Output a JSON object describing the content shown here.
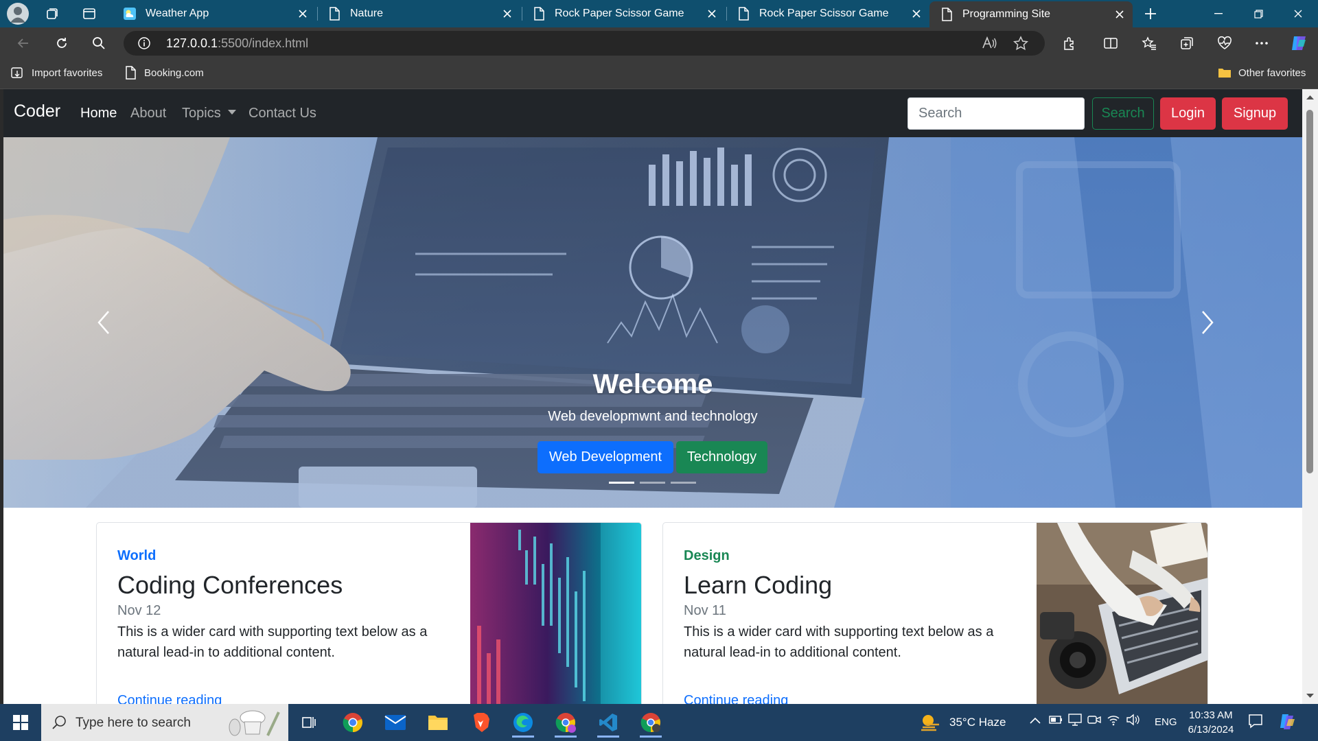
{
  "browser": {
    "tabs": [
      {
        "title": "Weather App",
        "active": false
      },
      {
        "title": "Nature",
        "active": false
      },
      {
        "title": "Rock Paper Scissor Game",
        "active": false
      },
      {
        "title": "Rock Paper Scissor Game",
        "active": false
      },
      {
        "title": "Programming Site",
        "active": true
      }
    ],
    "url_host": "127.0.0.1",
    "url_path": ":5500/index.html",
    "bookmarks": {
      "import": "Import favorites",
      "booking": "Booking.com",
      "other": "Other favorites"
    }
  },
  "site": {
    "brand": "Coder",
    "nav": {
      "home": "Home",
      "about": "About",
      "topics": "Topics",
      "contact": "Contact Us"
    },
    "search_placeholder": "Search",
    "search_button": "Search",
    "login": "Login",
    "signup": "Signup",
    "carousel": {
      "title": "Welcome",
      "subtitle": "Web developmwnt and technology",
      "btn_primary": "Web Development",
      "btn_success": "Technology",
      "slides": 3,
      "active_slide": 1
    },
    "cards": [
      {
        "category": "World",
        "category_color": "#0d6efd",
        "title": "Coding Conferences",
        "date": "Nov 12",
        "text": "This is a wider card with supporting text below as a natural lead-in to additional content.",
        "link": "Continue reading"
      },
      {
        "category": "Design",
        "category_color": "#198754",
        "title": "Learn Coding",
        "date": "Nov 11",
        "text": "This is a wider card with supporting text below as a natural lead-in to additional content.",
        "link": "Continue reading"
      }
    ]
  },
  "taskbar": {
    "search_placeholder": "Type here to search",
    "weather": "35°C  Haze",
    "language": "ENG",
    "time": "10:33 AM",
    "date": "6/13/2024"
  },
  "colors": {
    "primary": "#0d6efd",
    "success": "#198754",
    "danger": "#dc3545",
    "navbar": "#212529",
    "tabstrip": "#0f4f6e"
  }
}
